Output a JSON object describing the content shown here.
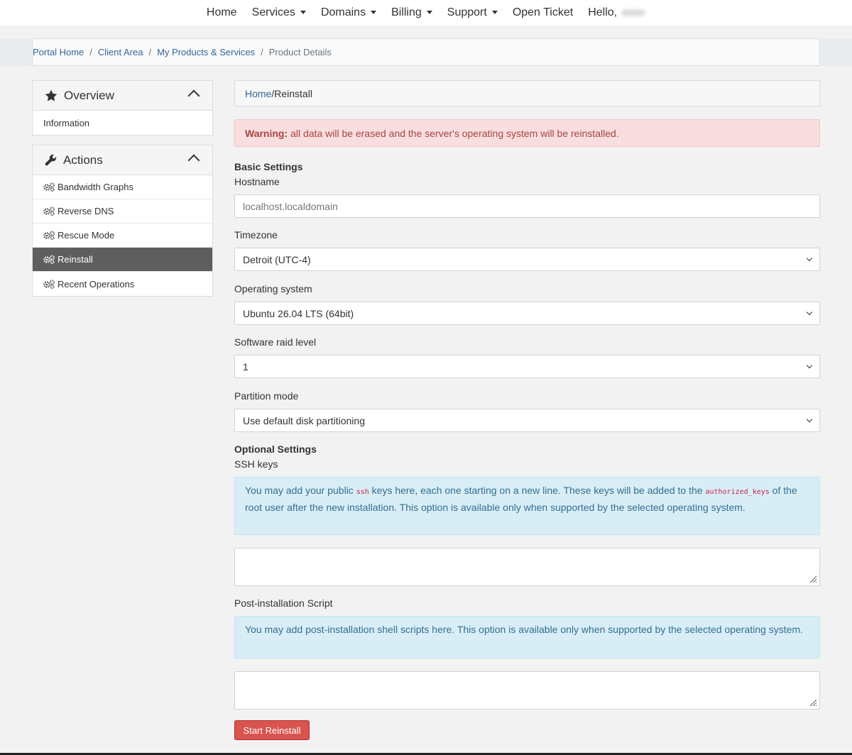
{
  "nav": {
    "home": "Home",
    "services": "Services",
    "domains": "Domains",
    "billing": "Billing",
    "support": "Support",
    "open_ticket": "Open Ticket",
    "hello": "Hello,"
  },
  "breadcrumb": {
    "items": [
      "Portal Home",
      "Client Area",
      "My Products & Services"
    ],
    "current": "Product Details",
    "separator": "/"
  },
  "sidebar": {
    "overview": {
      "title": "Overview",
      "icon": "star-icon",
      "items": [
        "Information"
      ]
    },
    "actions": {
      "title": "Actions",
      "icon": "wrench-icon",
      "items": [
        "Bandwidth Graphs",
        "Reverse DNS",
        "Rescue Mode",
        "Reinstall",
        "Recent Operations"
      ],
      "active": "Reinstall"
    }
  },
  "main": {
    "sub_crumb": {
      "home": "Home",
      "sep": "/",
      "current": "Reinstall"
    },
    "warning": {
      "strong": "Warning:",
      "text": "all data will be erased and the server's operating system will be reinstalled."
    },
    "basic_settings": "Basic Settings",
    "hostname": {
      "label": "Hostname",
      "placeholder": "localhost.localdomain"
    },
    "timezone": {
      "label": "Timezone",
      "value": "Detroit (UTC-4)"
    },
    "os": {
      "label": "Operating system",
      "value": "Ubuntu 26.04 LTS (64bit)"
    },
    "raid": {
      "label": "Software raid level",
      "value": "1"
    },
    "partition": {
      "label": "Partition mode",
      "value": "Use default disk partitioning"
    },
    "optional_settings": "Optional Settings",
    "ssh": {
      "label": "SSH keys",
      "info_1": "You may add your public",
      "code_1": "ssh",
      "info_2": "keys here, each one starting on a new line. These keys will be added to the",
      "code_2": "authorized_keys",
      "info_3": "of the root user after the new installation. This option is available only when supported by the selected operating system."
    },
    "script": {
      "label": "Post-installation Script",
      "info": "You may add post-installation shell scripts here. This option is available only when supported by the selected operating system."
    },
    "submit": "Start Reinstall"
  },
  "colors": {
    "link": "#336699",
    "danger": "#d9534f",
    "info_bg": "#d9edf7",
    "active_item": "#5e5e5e"
  }
}
